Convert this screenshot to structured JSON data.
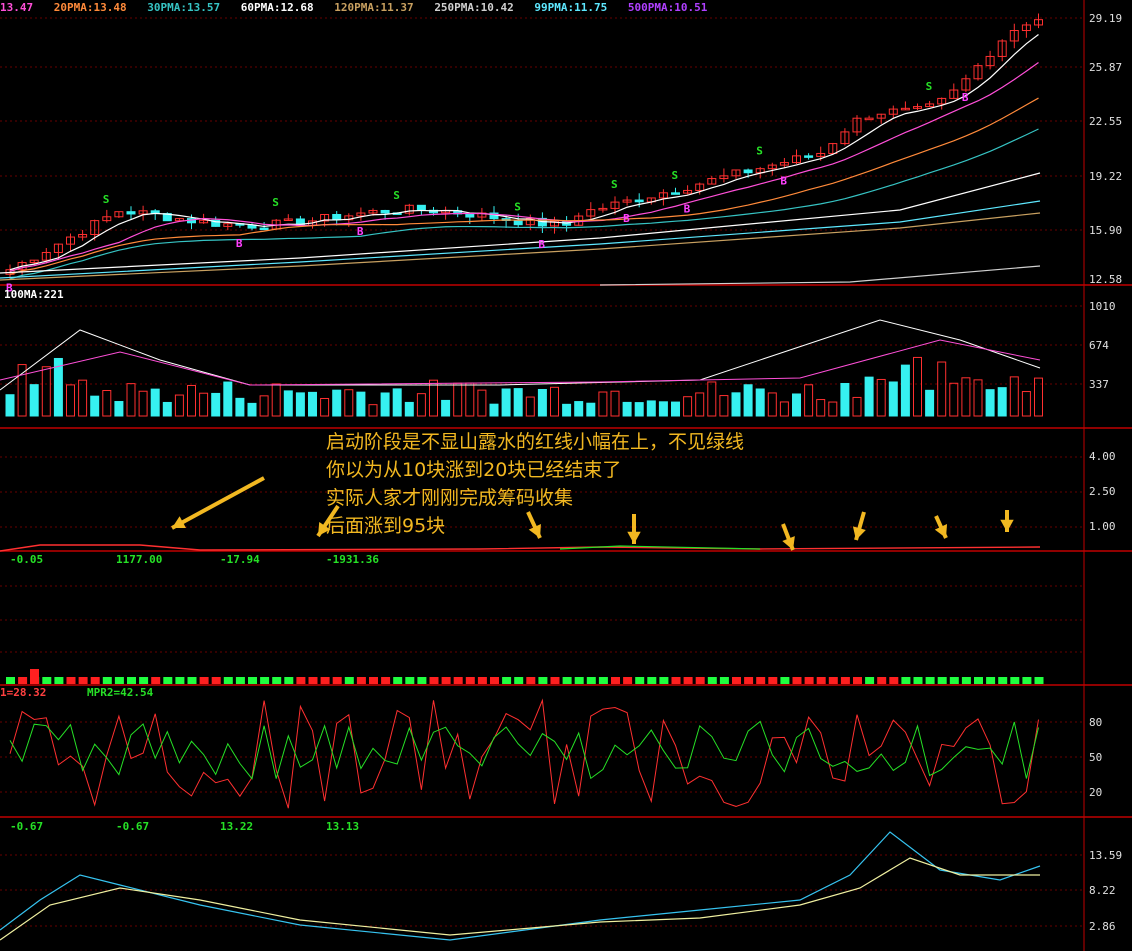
{
  "price_legend": [
    {
      "text": "13.47",
      "color": "#ff4fd8"
    },
    {
      "text": "20PMA:13.48",
      "color": "#ff8a3a"
    },
    {
      "text": "30PMA:13.57",
      "color": "#36c3c3"
    },
    {
      "text": "60PMA:12.68",
      "color": "#ffffff"
    },
    {
      "text": "120PMA:11.37",
      "color": "#c8a060"
    },
    {
      "text": "250PMA:10.42",
      "color": "#d0d0d0"
    },
    {
      "text": "99PMA:11.75",
      "color": "#5ee8ff"
    },
    {
      "text": "500PMA:10.51",
      "color": "#b040ff"
    }
  ],
  "price_axis": [
    "29.19",
    "25.87",
    "22.55",
    "19.22",
    "15.90",
    "12.58"
  ],
  "volume_legend": "100MA:221",
  "volume_axis": [
    "1010",
    "674",
    "337"
  ],
  "indicator3_axis": [
    "4.00",
    "2.50",
    "1.00"
  ],
  "indicator3_values": [
    "-0.05",
    "1177.00",
    "-17.94",
    "-1931.36"
  ],
  "annotation_lines": [
    "启动阶段是不显山露水的红线小幅在上，不见绿线",
    "你以为从10块涨到20块已经结束了",
    "实际人家才刚刚完成筹码收集",
    "后面涨到95块"
  ],
  "wr_legend": [
    {
      "text": "1=28.32",
      "color": "#ff4040"
    },
    {
      "text": "MPR2=42.54",
      "color": "#26e026"
    }
  ],
  "wr_axis": [
    "80",
    "50",
    "20"
  ],
  "bottom_values": [
    "-0.67",
    "-0.67",
    "13.22",
    "13.13"
  ],
  "bottom_axis": [
    "13.59",
    "8.22",
    "2.86"
  ],
  "chart_data": {
    "type": "line",
    "title": "",
    "price_range": [
      12.58,
      29.19
    ],
    "ma_series": [
      {
        "name": "20PMA",
        "value": 13.48
      },
      {
        "name": "30PMA",
        "value": 13.57
      },
      {
        "name": "60PMA",
        "value": 12.68
      },
      {
        "name": "120PMA",
        "value": 11.37
      },
      {
        "name": "250PMA",
        "value": 10.42
      },
      {
        "name": "99PMA",
        "value": 11.75
      },
      {
        "name": "500PMA",
        "value": 10.51
      }
    ],
    "signals": {
      "S": "#26e026",
      "B": "#ff40ff"
    }
  }
}
